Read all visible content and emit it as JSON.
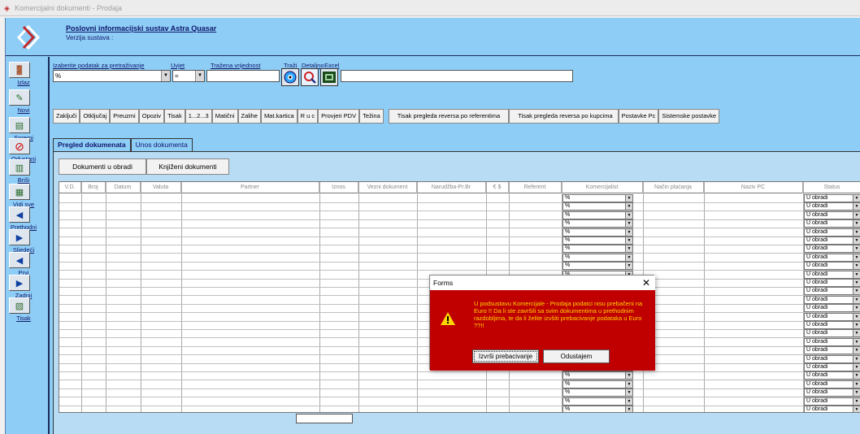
{
  "window": {
    "title": "Komercijalni dokumenti - Prodaja"
  },
  "header": {
    "title": "Poslovni informacijski sustav Astra Quasar",
    "version": "Verzija sustava :"
  },
  "sidebar": {
    "items": [
      {
        "label": "Izlaz",
        "icon": "exit-door-icon"
      },
      {
        "label": "Novi",
        "icon": "new-pencil-icon"
      },
      {
        "label": "Spremi",
        "icon": "save-icon"
      },
      {
        "label": "Odustani",
        "icon": "cancel-icon"
      },
      {
        "label": "Briši",
        "icon": "delete-bin-icon"
      },
      {
        "label": "Vidi sve",
        "icon": "view-all-icon"
      },
      {
        "label": "Prethodni",
        "icon": "prev-arrow-icon"
      },
      {
        "label": "Sljedeći",
        "icon": "next-arrow-icon"
      },
      {
        "label": "Prvi",
        "icon": "first-arrow-icon"
      },
      {
        "label": "Zadnji",
        "icon": "last-arrow-icon"
      },
      {
        "label": "Tisak",
        "icon": "print-icon"
      }
    ]
  },
  "filter": {
    "field_label": "Izaberite podatak za pretraživanje",
    "field_value": "%",
    "condition_label": "Uvjet",
    "condition_value": "=",
    "value_label": "Tražena vrijednost",
    "value_value": "",
    "search_label": "Traži",
    "detail_label": "Detaljno",
    "excel_label": "Excel"
  },
  "toolbar": {
    "buttons": [
      "Zaključi",
      "Otključaj",
      "Preuzmi",
      "Opoziv",
      "Tisak",
      "1...2...3",
      "Matični",
      "Zalihe",
      "Mat.kartica",
      "R u c",
      "Provjeri PDV",
      "Težina",
      "Tisak pregleda reversa po referentima",
      "Tisak pregleda reversa po kupcima",
      "Postavke Pc",
      "Sistemske postavke"
    ]
  },
  "tabs": [
    {
      "label": "Pregled dokumenata",
      "active": true
    },
    {
      "label": "Unos dokumenta",
      "active": false
    }
  ],
  "subtabs": {
    "in_process": "Dokumenti u obradi",
    "posted": "Knjiženi dokumenti"
  },
  "grid": {
    "columns": [
      "V.D.",
      "Broj",
      "Datum",
      "Valuta",
      "Partner",
      "Iznos",
      "Vezni dokument",
      "Narudžba-Pr.Br",
      "€ $",
      "Referent",
      "Komercijalist",
      "Način plaćanja",
      "Naziv PC",
      "Status"
    ],
    "row_komercijalist": "%",
    "row_status": "U obradi",
    "row_count": 26
  },
  "dialog": {
    "title": "Forms",
    "message": "U podsustavu Komercijale - Prodaja podatci nisu prebačeni na Euro !! Da li ste završili sa svim dokumentima u prethodnim razdobljima, te da li želite izvšiti prebacivanje podataka u Euro ??!!",
    "confirm": "Izvrši prebacivanje",
    "cancel": "Odustajem"
  },
  "colors": {
    "app_bg": "#8ecdf6",
    "dialog_bg": "#c00000",
    "dialog_text": "#ffd400"
  }
}
